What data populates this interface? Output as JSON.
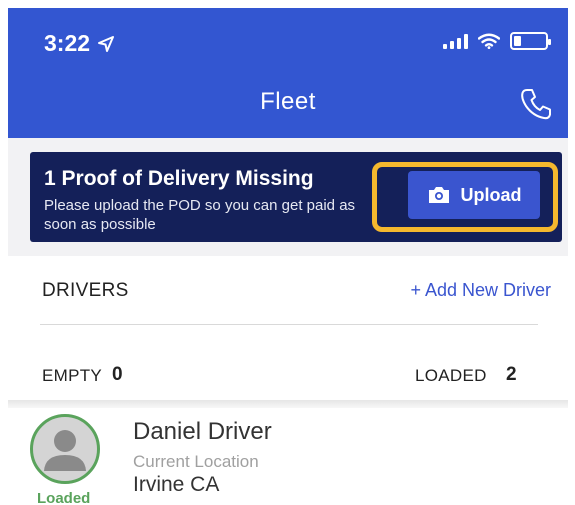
{
  "status_bar": {
    "time": "3:22"
  },
  "header": {
    "title": "Fleet"
  },
  "banner": {
    "title": "1 Proof of Delivery Missing",
    "message": "Please upload the POD so you can get paid as soon as possible",
    "upload_label": "Upload"
  },
  "drivers": {
    "section_label": "DRIVERS",
    "add_label": "+ Add New Driver"
  },
  "counts": {
    "empty_label": "EMPTY",
    "empty_value": "0",
    "loaded_label": "LOADED",
    "loaded_value": "2"
  },
  "driver_card": {
    "status": "Loaded",
    "name": "Daniel Driver",
    "location_label": "Current Location",
    "location_value": "Irvine CA"
  },
  "colors": {
    "header_blue": "#3356d1",
    "banner_navy": "#142059",
    "highlight_yellow": "#f5b82e",
    "accent_blue": "#3a55cf",
    "loaded_green": "#5aa35c"
  }
}
